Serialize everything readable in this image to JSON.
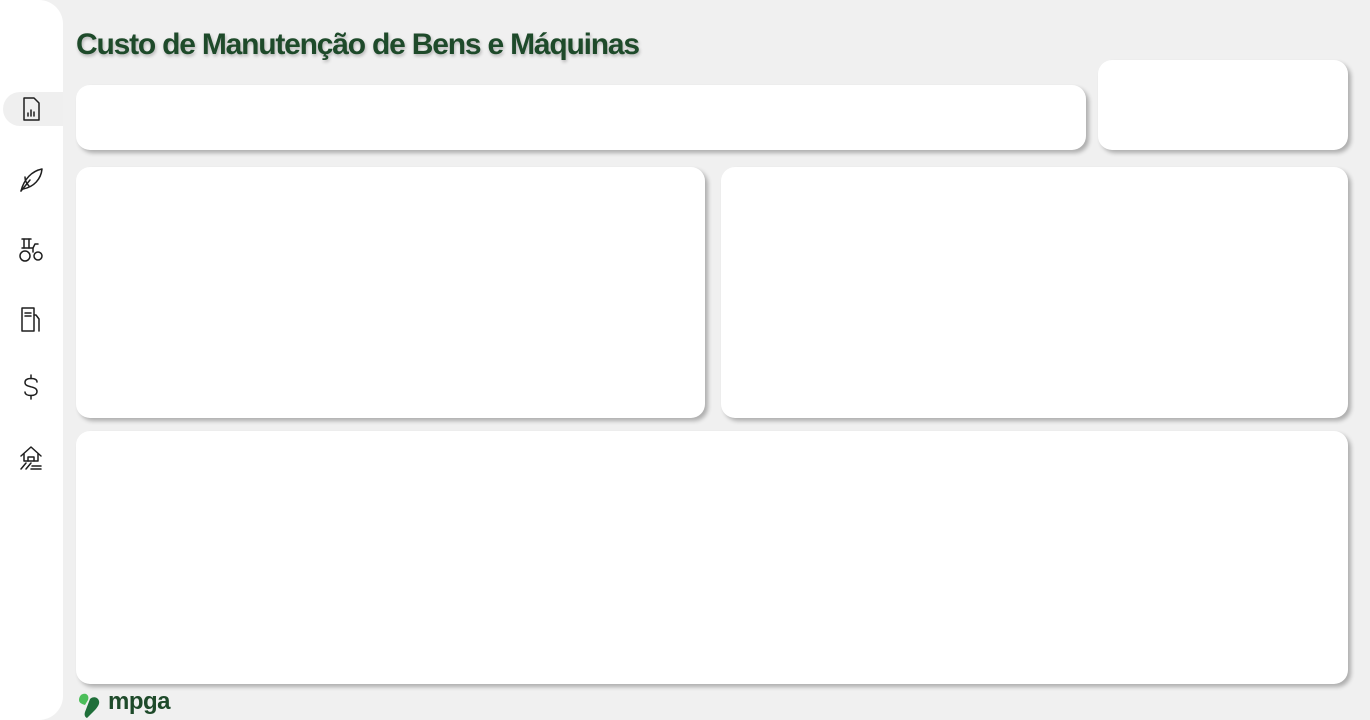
{
  "header": {
    "title": "Custo de Manutenção de Bens e Máquinas"
  },
  "sidebar": {
    "items": [
      {
        "icon": "report-chart-icon",
        "active": true
      },
      {
        "icon": "leaf-icon",
        "active": false
      },
      {
        "icon": "tractor-icon",
        "active": false
      },
      {
        "icon": "fuel-pump-icon",
        "active": false
      },
      {
        "icon": "dollar-icon",
        "active": false
      },
      {
        "icon": "farm-house-icon",
        "active": false
      }
    ]
  },
  "footer": {
    "logo_text": "mpga"
  },
  "colors": {
    "brand_green": "#1e4a2a",
    "logo_light_green": "#4cbe5a",
    "logo_dark_green": "#1f6f3a",
    "background": "#f0f0f0",
    "card": "#ffffff"
  }
}
